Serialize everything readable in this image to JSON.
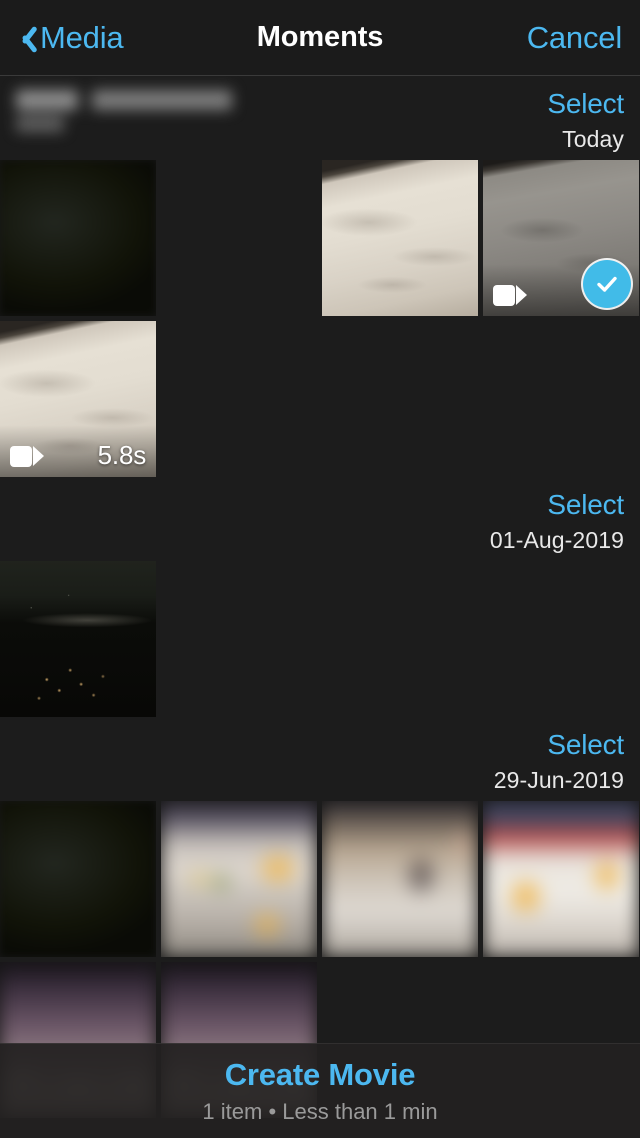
{
  "nav": {
    "back_label": "Media",
    "back_icon": "chevron-left-icon",
    "title": "Moments",
    "cancel_label": "Cancel"
  },
  "colors": {
    "accent": "#4cb8f0",
    "selection": "#41bbe8",
    "background": "#1c1c1c",
    "navbar": "#1b1b1b",
    "text_primary": "#ffffff",
    "text_secondary": "#9a9a9a"
  },
  "sections": [
    {
      "select_label": "Select",
      "date_label": "Today",
      "items": [
        {
          "name": "redacted-screenshot",
          "kind": "photo",
          "style": "t-blurdark",
          "redacted": true,
          "selected": false
        },
        {
          "name": "empty-slot-1",
          "kind": "blank",
          "style": "",
          "selected": false
        },
        {
          "name": "marble-video-bright",
          "kind": "photo",
          "style": "t-marble-bright",
          "selected": false
        },
        {
          "name": "marble-video-selected",
          "kind": "video",
          "style": "t-marble-dark",
          "selected": true
        },
        {
          "name": "marble-video-duration",
          "kind": "video",
          "style": "t-marble-bright",
          "duration": "5.8s",
          "selected": false
        }
      ]
    },
    {
      "select_label": "Select",
      "date_label": "01-Aug-2019",
      "items": [
        {
          "name": "night-city-photo",
          "kind": "photo",
          "style": "t-night",
          "selected": false
        }
      ]
    },
    {
      "select_label": "Select",
      "date_label": "29-Jun-2019",
      "items": [
        {
          "name": "dark-foliage-photo",
          "kind": "photo",
          "style": "t-blurblack",
          "selected": false
        },
        {
          "name": "shelf-jars-photo",
          "kind": "photo",
          "style": "t-blurshelf",
          "selected": false
        },
        {
          "name": "shelf-figures-photo",
          "kind": "photo",
          "style": "t-blurshelf2",
          "selected": false
        },
        {
          "name": "orange-jars-photo",
          "kind": "photo",
          "style": "t-blurjars",
          "selected": false
        },
        {
          "name": "purple-lamps-photo",
          "kind": "photo",
          "style": "t-blurpurple",
          "selected": false
        },
        {
          "name": "purple-lamps-photo-2",
          "kind": "photo",
          "style": "t-blurpurple",
          "selected": false
        }
      ]
    }
  ],
  "bottom_bar": {
    "action_label": "Create Movie",
    "summary": "1 item • Less than 1 min"
  }
}
